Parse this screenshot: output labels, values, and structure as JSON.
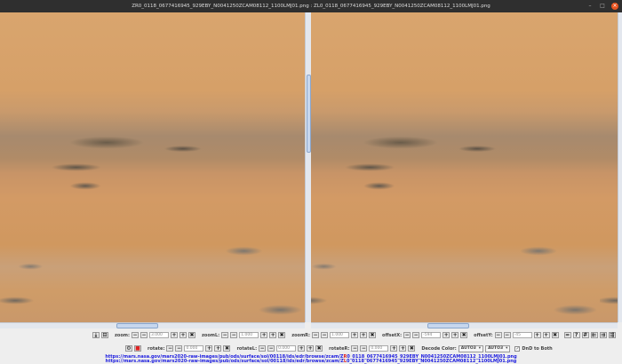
{
  "window": {
    "title": "ZR0_0118_0677416945_929EBY_N0041250ZCAM08112_1100LMJ01.png : ZL0_0118_0677416945_929EBY_N0041250ZCAM08112_1100LMJ01.png",
    "minimize": "–",
    "maximize": "□",
    "close": "×"
  },
  "toolbar1": {
    "download": "⤓",
    "minus_box": "⊟",
    "zoom_label": "zoom:",
    "zoom_value": "3.000",
    "zoomL_label": "zoomL:",
    "zoomL_value": "1.000",
    "zoomR_label": "zoomR:",
    "zoomR_value": "1.000",
    "offsetX_label": "offsetX:",
    "offsetX_value": "-594",
    "offsetY_label": "offsetY:",
    "offsetY_value": "-45",
    "dec": "−",
    "dec2": "−",
    "inc": "+",
    "inc2": "+",
    "reset": "✖",
    "eq": "=",
    "help": "?",
    "grid": "#",
    "align1": "⇇",
    "align2": "⇉",
    "align3": "⇶"
  },
  "toolbar2": {
    "gear": "⚙",
    "color": "■",
    "rotate_label": "rotate:",
    "rotate_value": "0.000",
    "rotateL_label": "rotateL:",
    "rotateL_value": "0.000",
    "rotateR_label": "rotateR:",
    "rotateR_value": "0.000",
    "decode_label": "Decode Color:",
    "decode1": "AUTO3",
    "decode2": "AUTO3",
    "dnd_label": "DnD to Both",
    "dnd_checked": "✓",
    "arrow": "▾"
  },
  "links": {
    "right": {
      "prefix": "https://mars.nasa.gov/mars2020-raw-images/pub/ods/surface/sol/00118/ids/edr/browse/zcam/Z",
      "eye": "R",
      "suffix": "0_0118_0677416945_929EBY_N0041250ZCAM08112_1100LMJ01.png"
    },
    "left": {
      "prefix": "https://mars.nasa.gov/mars2020-raw-images/pub/ods/surface/sol/00118/ids/edr/browse/zcam/Z",
      "eye": "L",
      "suffix": "0_0118_0677416945_929EBY_N0041250ZCAM08112_1100LMJ01.png"
    }
  }
}
